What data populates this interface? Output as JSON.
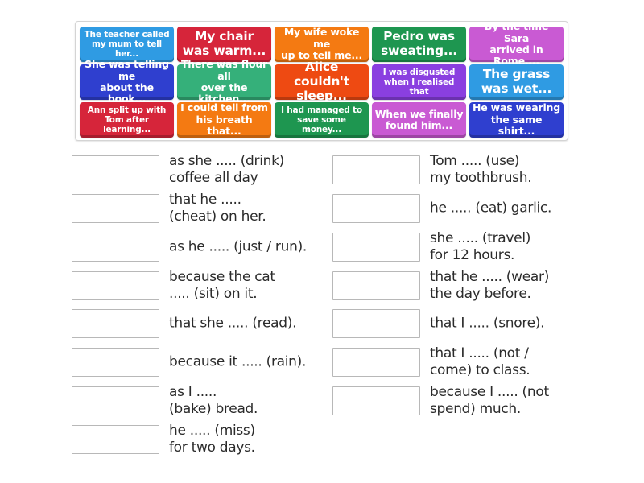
{
  "tile_bank": {
    "tiles": [
      {
        "text": "The teacher called\nmy mum to tell her...",
        "color": "#2f9be3",
        "size": "s"
      },
      {
        "text": "My chair\nwas warm...",
        "color": "#d6253a",
        "size": "l"
      },
      {
        "text": "My wife woke me\nup to tell me...",
        "color": "#f47a12",
        "size": "m"
      },
      {
        "text": "Pedro was\nsweating...",
        "color": "#1e9650",
        "size": "l"
      },
      {
        "text": "By the time Sara\narrived in Rome,...",
        "color": "#c95ad3",
        "size": "m"
      },
      {
        "text": "She was telling me\nabout the book...",
        "color": "#2f3fcf",
        "size": "m"
      },
      {
        "text": "There was flour all\nover the kitchen...",
        "color": "#35b07a",
        "size": "m"
      },
      {
        "text": "Alice couldn't\nsleep...",
        "color": "#ee4a12",
        "size": "l"
      },
      {
        "text": "I was disgusted\nwhen I realised that",
        "color": "#8a3fe0",
        "size": "s"
      },
      {
        "text": "The grass\nwas wet...",
        "color": "#2f9be3",
        "size": "l"
      },
      {
        "text": "Ann split up with\nTom after learning...",
        "color": "#d6253a",
        "size": "s"
      },
      {
        "text": "I could tell from\nhis breath that...",
        "color": "#f47a12",
        "size": "m"
      },
      {
        "text": "I had managed to\nsave some money...",
        "color": "#1e9650",
        "size": "s"
      },
      {
        "text": "When we finally\nfound him...",
        "color": "#c95ad3",
        "size": "m"
      },
      {
        "text": "He was wearing\nthe same shirt...",
        "color": "#2f3fcf",
        "size": "m"
      }
    ]
  },
  "answers": {
    "left": [
      {
        "text": "as she ..... (drink)\ncoffee all day",
        "value": ""
      },
      {
        "text": "that he .....\n(cheat) on her.",
        "value": ""
      },
      {
        "text": "as he ..... (just / run).",
        "value": ""
      },
      {
        "text": "because the cat\n..... (sit) on it.",
        "value": ""
      },
      {
        "text": "that she ..... (read).",
        "value": ""
      },
      {
        "text": "because it ..... (rain).",
        "value": ""
      },
      {
        "text": "as I .....\n(bake) bread.",
        "value": ""
      },
      {
        "text": "he ..... (miss)\nfor two days.",
        "value": ""
      }
    ],
    "right": [
      {
        "text": "Tom ..... (use)\nmy toothbrush.",
        "value": ""
      },
      {
        "text": "he ..... (eat) garlic.",
        "value": ""
      },
      {
        "text": "she ..... (travel)\nfor 12 hours.",
        "value": ""
      },
      {
        "text": "that he ..... (wear)\nthe day before.",
        "value": ""
      },
      {
        "text": "that I ..... (snore).",
        "value": ""
      },
      {
        "text": "that I ..... (not /\ncome) to class.",
        "value": ""
      },
      {
        "text": "because I ..... (not\nspend) much.",
        "value": ""
      }
    ]
  }
}
